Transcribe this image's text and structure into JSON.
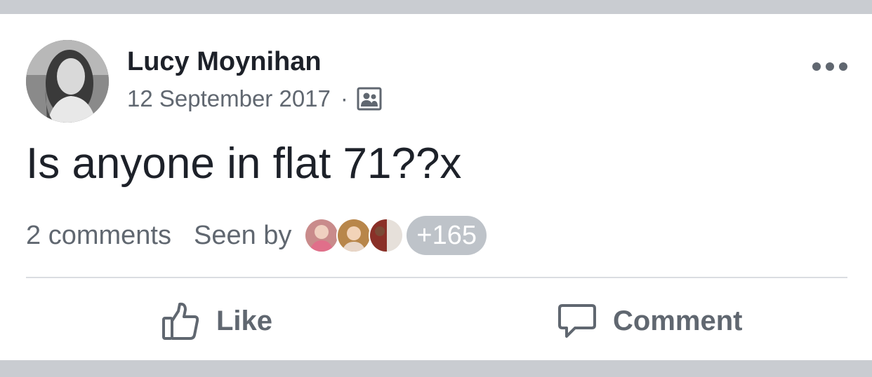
{
  "post": {
    "author": "Lucy Moynihan",
    "date": "12 September 2017",
    "separator": "·",
    "audience_icon": "group-audience-icon",
    "more_icon": "more-options-icon",
    "text": "Is anyone in flat 71??x"
  },
  "stats": {
    "comments": "2 comments",
    "seen_by_label": "Seen by",
    "seen_avatars": [
      "viewer-avatar-1",
      "viewer-avatar-2",
      "viewer-avatar-3"
    ],
    "seen_count": "+165"
  },
  "actions": {
    "like_label": "Like",
    "like_icon": "thumbs-up-icon",
    "comment_label": "Comment",
    "comment_icon": "speech-bubble-icon"
  },
  "colors": {
    "band": "#c9ccd1",
    "text_primary": "#1d2129",
    "text_secondary": "#606770",
    "divider": "#dadde1",
    "seen_badge": "#bec3c9"
  }
}
